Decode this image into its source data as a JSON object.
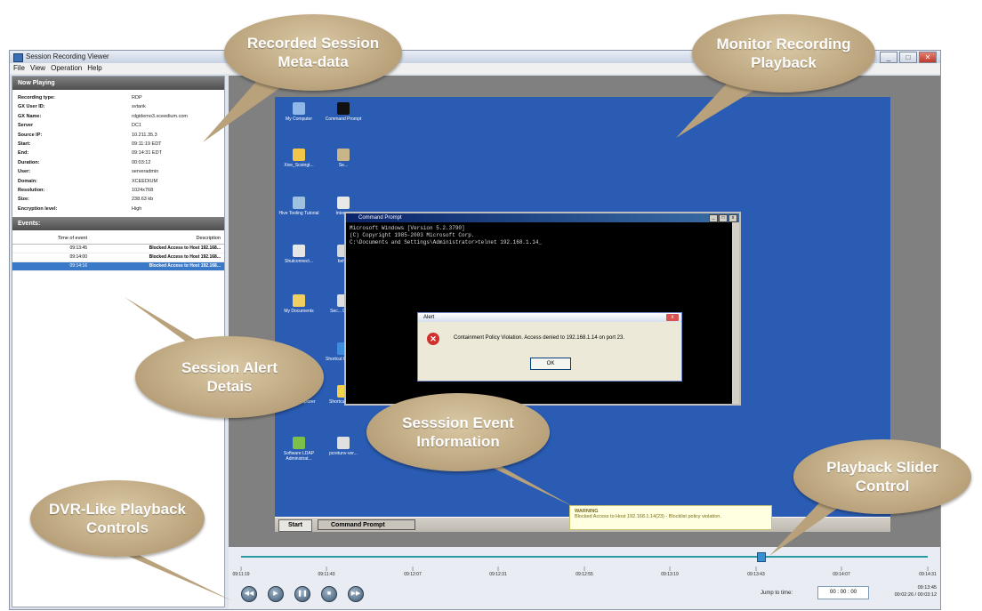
{
  "window": {
    "title": "Session Recording Viewer",
    "menu": [
      "File",
      "View",
      "Operation",
      "Help"
    ],
    "controls": {
      "minimize": "_",
      "maximize": "□",
      "close": "✕"
    }
  },
  "now_playing": {
    "header": "Now Playing",
    "fields": [
      {
        "key": "Recording type:",
        "value": "RDP"
      },
      {
        "key": "GX User ID:",
        "value": "svtank"
      },
      {
        "key": "GX Name:",
        "value": "rdgidemo3.xceedium.com"
      },
      {
        "key": "Server",
        "value": "DC1"
      },
      {
        "key": "Source IP:",
        "value": "10.211.35.3"
      },
      {
        "key": "Start:",
        "value": "09:11:19 EDT"
      },
      {
        "key": "End:",
        "value": "09:14:31 EDT"
      },
      {
        "key": "Duration:",
        "value": "00:03:12"
      },
      {
        "key": "User:",
        "value": "serveradmin"
      },
      {
        "key": "Domain:",
        "value": "XCEEDIUM"
      },
      {
        "key": "Resolution:",
        "value": "1024x768"
      },
      {
        "key": "Size:",
        "value": "238.63 kb"
      },
      {
        "key": "Encryption level:",
        "value": "High"
      }
    ]
  },
  "events": {
    "header": "Events:",
    "col_time": "Time of event",
    "col_desc": "Description",
    "rows": [
      {
        "time": "09:13:45",
        "desc": "Blocked Access to Host 192.168..."
      },
      {
        "time": "09:14:00",
        "desc": "Blocked Access to Host 192.168..."
      },
      {
        "time": "09:14:16",
        "desc": "Blocked Access to Host 192.168..."
      }
    ]
  },
  "desktop": {
    "icons": [
      "My Computer",
      "Command Prompt",
      "Xive_Scoingt...",
      "Se...",
      "Hive Tooling Tutorial",
      "Intern...",
      "Shutconnect...",
      "beh...",
      "My Documents",
      "Sec... Desk...",
      "Shortcut to tag.A1",
      "Internet Explorer",
      "Shortcut to file",
      "Software LDAP Administrat...",
      "pcretunv-ver..."
    ],
    "start": "Start",
    "taskbar_item": "Command Prompt"
  },
  "cmd": {
    "title": "Command Prompt",
    "lines": [
      "Microsoft Windows [Version 5.2.3790]",
      "(C) Copyright 1985-2003 Microsoft Corp.",
      "",
      "C:\\Documents and Settings\\Administrator>telnet 192.168.1.14_"
    ]
  },
  "alert": {
    "title": "Alert",
    "message": "Containment Policy Violation. Access denied to 192.168.1.14 on port 23.",
    "ok": "OK"
  },
  "tooltip": {
    "line1": "WARNING",
    "line2": "Blocked Access to Host 192.168.1.14(23) - Blocklist policy violation."
  },
  "timeline": {
    "ticks": [
      "09:11:19",
      "09:11:43",
      "09:12:07",
      "09:12:31",
      "09:12:55",
      "09:13:19",
      "09:13:43",
      "09:14:07",
      "09:14:31"
    ],
    "thumb_time": "09:13:45",
    "position_fraction": 0.75
  },
  "playback": {
    "jump_label": "Jump to time:",
    "jump_value": "00 : 00 : 00",
    "current": "09:13:45",
    "progress": "00:02:26 / 00:03:12",
    "buttons": [
      "rewind",
      "play",
      "pause",
      "stop",
      "fast-forward"
    ]
  },
  "callouts": {
    "meta": "Recorded Session Meta-data",
    "monitor": "Monitor Recording Playback",
    "alert": "Session Alert Detais",
    "event": "Sesssion Event Information",
    "slider": "Playback Slider Control",
    "dvr": "DVR-Like Playback Controls"
  },
  "colors": {
    "callout": "#b9a27b",
    "desktop": "#2a5cb4",
    "header": "#5a5a5a",
    "selection": "#3a79c7"
  }
}
